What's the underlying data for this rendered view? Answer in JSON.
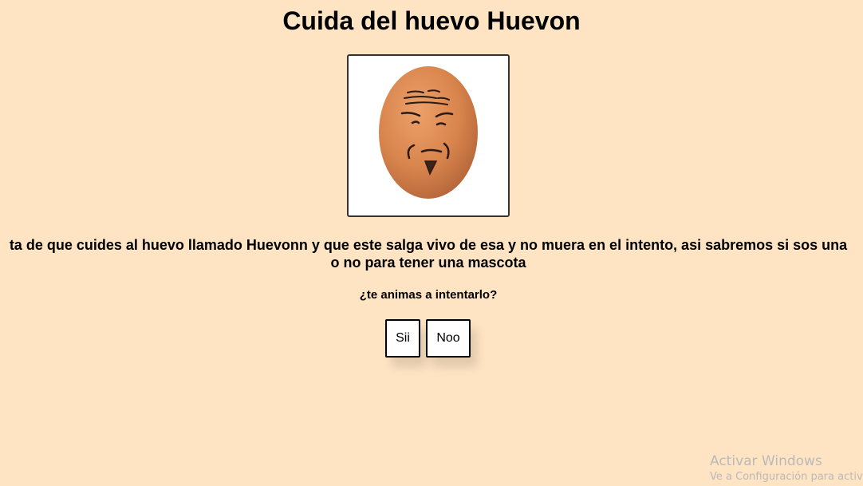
{
  "page": {
    "title": "Cuida del huevo Huevon",
    "description_line1": "ta de que cuides al huevo llamado Huevonn y que este salga vivo de esa y no muera en el intento, asi sabremos si sos una",
    "description_line2": "o no para tener una mascota",
    "question": "¿te animas a intentarlo?"
  },
  "buttons": {
    "yes_label": "Sii",
    "no_label": "Noo"
  },
  "watermark": {
    "title": "Activar Windows",
    "subtitle": "Ve a Configuración para activ"
  },
  "colors": {
    "background": "#ffe4c4",
    "egg": "#d8844c",
    "frame_border": "#333333"
  },
  "icons": {
    "egg_image": "egg-face-illustration"
  }
}
